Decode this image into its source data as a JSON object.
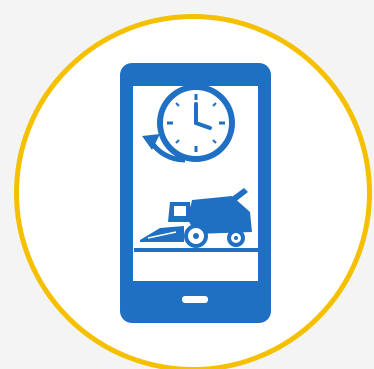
{
  "colors": {
    "background": "#f4f4f4",
    "ring": "#f5c000",
    "badge_fill": "#ffffff",
    "icon_blue": "#1f6fc3"
  },
  "icons": {
    "phone": "smartphone-icon",
    "clock": "clock-icon",
    "history_arrow": "history-arrow-icon",
    "machine": "combine-harvester-icon"
  }
}
